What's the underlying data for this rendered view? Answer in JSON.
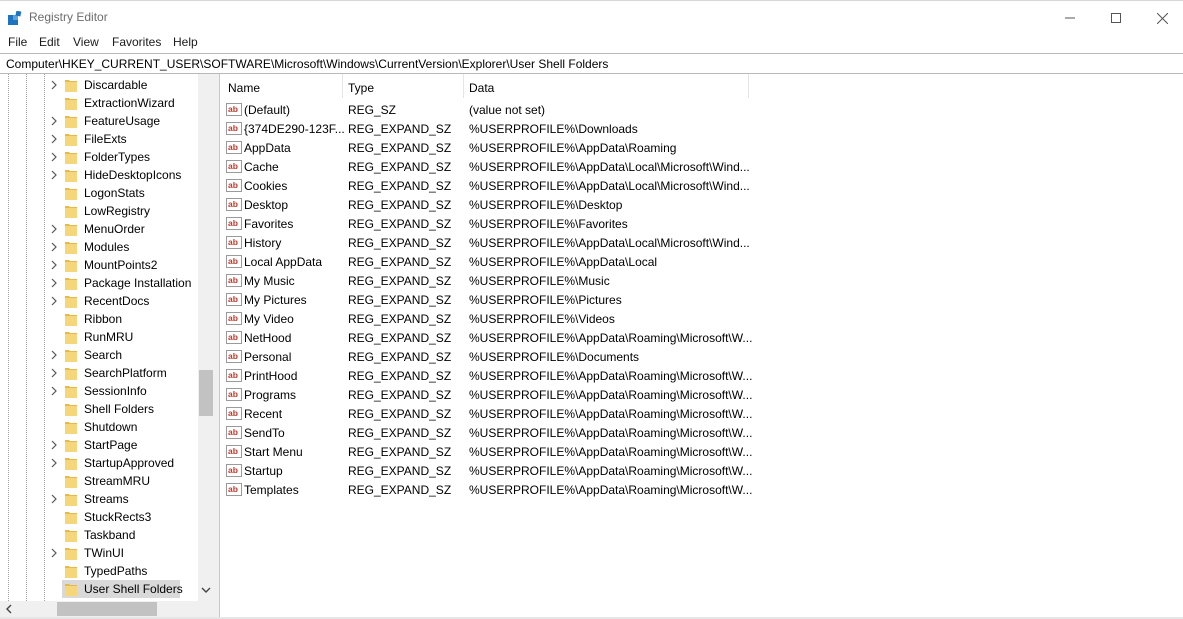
{
  "window": {
    "title": "Registry Editor",
    "controls": {
      "minimize_icon": "minimize-icon",
      "maximize_icon": "maximize-icon",
      "close_icon": "close-icon"
    }
  },
  "menu": {
    "items": [
      "File",
      "Edit",
      "View",
      "Favorites",
      "Help"
    ]
  },
  "address": {
    "path": "Computer\\HKEY_CURRENT_USER\\SOFTWARE\\Microsoft\\Windows\\CurrentVersion\\Explorer\\User Shell Folders"
  },
  "tree": {
    "items": [
      "Discardable",
      "ExtractionWizard",
      "FeatureUsage",
      "FileExts",
      "FolderTypes",
      "HideDesktopIcons",
      "LogonStats",
      "LowRegistry",
      "MenuOrder",
      "Modules",
      "MountPoints2",
      "Package Installation",
      "RecentDocs",
      "Ribbon",
      "RunMRU",
      "Search",
      "SearchPlatform",
      "SessionInfo",
      "Shell Folders",
      "Shutdown",
      "StartPage",
      "StartupApproved",
      "StreamMRU",
      "Streams",
      "StuckRects3",
      "Taskband",
      "TWinUI",
      "TypedPaths",
      "User Shell Folders"
    ],
    "expandable": [
      true,
      false,
      true,
      true,
      true,
      true,
      false,
      false,
      true,
      true,
      true,
      true,
      true,
      false,
      false,
      true,
      true,
      true,
      false,
      false,
      true,
      true,
      false,
      true,
      false,
      false,
      true,
      false,
      false
    ],
    "selected": "User Shell Folders"
  },
  "list": {
    "columns": {
      "name": "Name",
      "type": "Type",
      "data": "Data"
    },
    "rows": [
      {
        "name": "(Default)",
        "type": "REG_SZ",
        "data": "(value not set)"
      },
      {
        "name": "{374DE290-123F...",
        "type": "REG_EXPAND_SZ",
        "data": "%USERPROFILE%\\Downloads"
      },
      {
        "name": "AppData",
        "type": "REG_EXPAND_SZ",
        "data": "%USERPROFILE%\\AppData\\Roaming"
      },
      {
        "name": "Cache",
        "type": "REG_EXPAND_SZ",
        "data": "%USERPROFILE%\\AppData\\Local\\Microsoft\\Wind..."
      },
      {
        "name": "Cookies",
        "type": "REG_EXPAND_SZ",
        "data": "%USERPROFILE%\\AppData\\Local\\Microsoft\\Wind..."
      },
      {
        "name": "Desktop",
        "type": "REG_EXPAND_SZ",
        "data": "%USERPROFILE%\\Desktop"
      },
      {
        "name": "Favorites",
        "type": "REG_EXPAND_SZ",
        "data": "%USERPROFILE%\\Favorites"
      },
      {
        "name": "History",
        "type": "REG_EXPAND_SZ",
        "data": "%USERPROFILE%\\AppData\\Local\\Microsoft\\Wind..."
      },
      {
        "name": "Local AppData",
        "type": "REG_EXPAND_SZ",
        "data": "%USERPROFILE%\\AppData\\Local"
      },
      {
        "name": "My Music",
        "type": "REG_EXPAND_SZ",
        "data": "%USERPROFILE%\\Music"
      },
      {
        "name": "My Pictures",
        "type": "REG_EXPAND_SZ",
        "data": "%USERPROFILE%\\Pictures"
      },
      {
        "name": "My Video",
        "type": "REG_EXPAND_SZ",
        "data": "%USERPROFILE%\\Videos"
      },
      {
        "name": "NetHood",
        "type": "REG_EXPAND_SZ",
        "data": "%USERPROFILE%\\AppData\\Roaming\\Microsoft\\W..."
      },
      {
        "name": "Personal",
        "type": "REG_EXPAND_SZ",
        "data": "%USERPROFILE%\\Documents"
      },
      {
        "name": "PrintHood",
        "type": "REG_EXPAND_SZ",
        "data": "%USERPROFILE%\\AppData\\Roaming\\Microsoft\\W..."
      },
      {
        "name": "Programs",
        "type": "REG_EXPAND_SZ",
        "data": "%USERPROFILE%\\AppData\\Roaming\\Microsoft\\W..."
      },
      {
        "name": "Recent",
        "type": "REG_EXPAND_SZ",
        "data": "%USERPROFILE%\\AppData\\Roaming\\Microsoft\\W..."
      },
      {
        "name": "SendTo",
        "type": "REG_EXPAND_SZ",
        "data": "%USERPROFILE%\\AppData\\Roaming\\Microsoft\\W..."
      },
      {
        "name": "Start Menu",
        "type": "REG_EXPAND_SZ",
        "data": "%USERPROFILE%\\AppData\\Roaming\\Microsoft\\W..."
      },
      {
        "name": "Startup",
        "type": "REG_EXPAND_SZ",
        "data": "%USERPROFILE%\\AppData\\Roaming\\Microsoft\\W..."
      },
      {
        "name": "Templates",
        "type": "REG_EXPAND_SZ",
        "data": "%USERPROFILE%\\AppData\\Roaming\\Microsoft\\W..."
      }
    ]
  },
  "icons": {
    "app": "registry-icon",
    "folder": "folder-icon",
    "value": "string-value-icon",
    "expand": "chevron-right-icon"
  },
  "colors": {
    "folder": "#f6d67b",
    "value_icon_red": "#c0392b",
    "selection": "#d9d9d9",
    "scroll_thumb": "#c2c2c2"
  }
}
